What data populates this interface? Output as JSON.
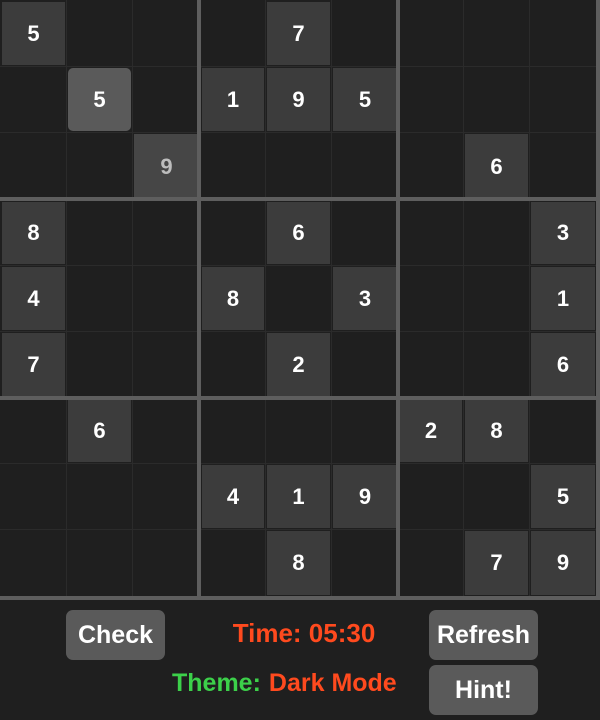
{
  "board": {
    "grid": [
      [
        "5",
        "",
        "",
        "",
        "7",
        "",
        "",
        "",
        ""
      ],
      [
        "",
        "5",
        "",
        "1",
        "9",
        "5",
        "",
        "",
        ""
      ],
      [
        "",
        "",
        "9",
        "",
        "",
        "",
        "",
        "6",
        ""
      ],
      [
        "8",
        "",
        "",
        "",
        "6",
        "",
        "",
        "",
        "3"
      ],
      [
        "4",
        "",
        "",
        "8",
        "",
        "3",
        "",
        "",
        "1"
      ],
      [
        "7",
        "",
        "",
        "",
        "2",
        "",
        "",
        "",
        "6"
      ],
      [
        "",
        "6",
        "",
        "",
        "",
        "",
        "2",
        "8",
        ""
      ],
      [
        "",
        "",
        "",
        "4",
        "1",
        "9",
        "",
        "",
        "5"
      ],
      [
        "",
        "",
        "",
        "",
        "8",
        "",
        "",
        "7",
        "9"
      ]
    ],
    "selected_cell": [
      1,
      1
    ],
    "dim_cells": [
      [
        2,
        2
      ]
    ]
  },
  "controls": {
    "check_label": "Check",
    "refresh_label": "Refresh",
    "hint_label": "Hint!",
    "timer_text": "Time: 05:30",
    "theme_label": "Theme:",
    "theme_value": "Dark Mode"
  },
  "colors": {
    "background": "#1f1f1f",
    "given_cell": "#3c3c3c",
    "selected_cell": "#5a5a5a",
    "grid_thick": "#5e5e5e",
    "timer": "#ff4a1e",
    "theme_label": "#3cd04a",
    "theme_value": "#ff4a1e",
    "button": "#5a5a5a"
  }
}
